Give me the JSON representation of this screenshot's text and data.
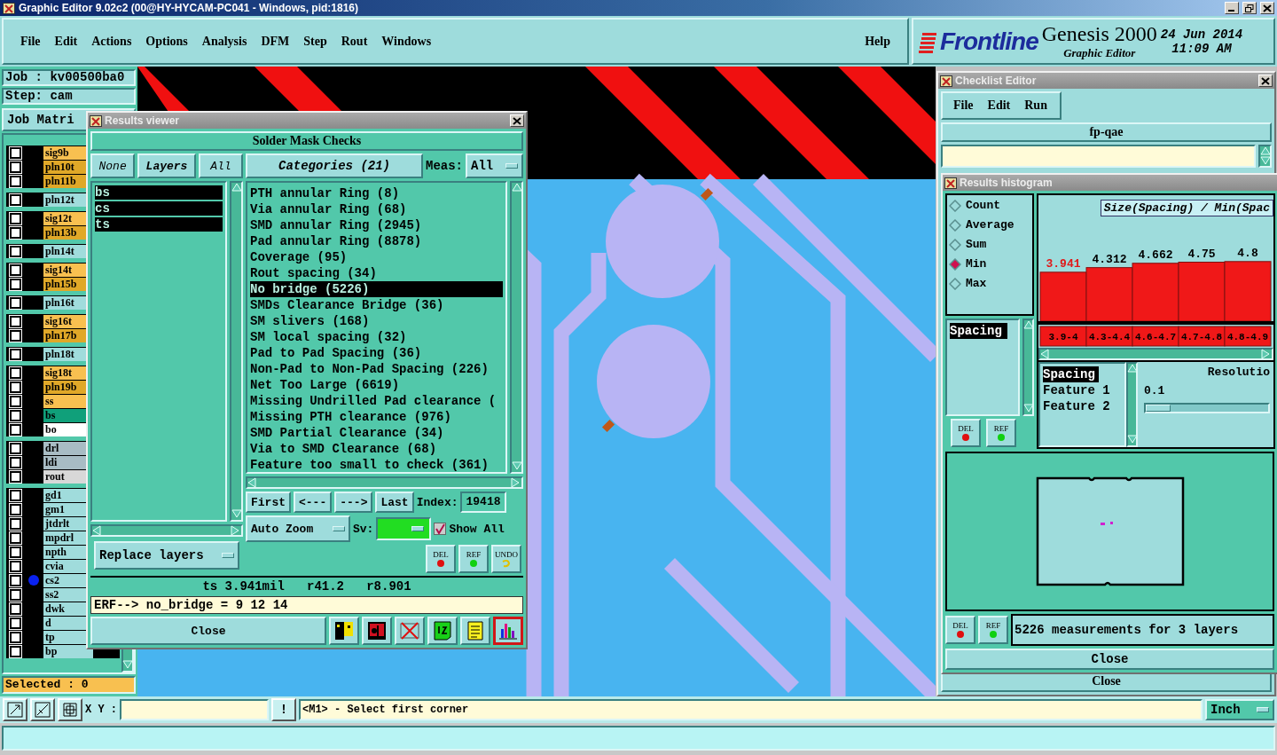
{
  "app_window": {
    "title": "Graphic Editor 9.02c2 (00@HY-HYCAM-PC041 - Windows, pid:1816)"
  },
  "menu": [
    "File",
    "Edit",
    "Actions",
    "Options",
    "Analysis",
    "DFM",
    "Step",
    "Rout",
    "Windows"
  ],
  "help_menu": "Help",
  "brand": {
    "logo": "Frontline",
    "product": "Genesis 2000",
    "date": "24 Jun 2014",
    "time": "11:09 AM",
    "subtitle": "Graphic Editor"
  },
  "job_panel": {
    "job": "Job : kv00500ba0",
    "step": "Step: cam",
    "matrix_button": "Job Matri",
    "selected_count": "Selected : 0",
    "layer_groups": [
      {
        "items": [
          {
            "name": "sig9b",
            "color": "#f8c050",
            "checked": false,
            "marked": false
          },
          {
            "name": "pln10t",
            "color": "#e0a828",
            "checked": false,
            "marked": false
          },
          {
            "name": "pln11b",
            "color": "#e0a828",
            "checked": false,
            "marked": false
          }
        ]
      },
      {
        "items": [
          {
            "name": "pln12t",
            "color": "#a0dcdc",
            "checked": false,
            "marked": false
          }
        ]
      },
      {
        "items": [
          {
            "name": "sig12t",
            "color": "#f8c050",
            "checked": false,
            "marked": false
          },
          {
            "name": "pln13b",
            "color": "#e0a828",
            "checked": false,
            "marked": false
          }
        ]
      },
      {
        "items": [
          {
            "name": "pln14t",
            "color": "#a0dcdc",
            "checked": false,
            "marked": false
          }
        ]
      },
      {
        "items": [
          {
            "name": "sig14t",
            "color": "#f8c050",
            "checked": false,
            "marked": false
          },
          {
            "name": "pln15b",
            "color": "#e0a828",
            "checked": false,
            "marked": false
          }
        ]
      },
      {
        "items": [
          {
            "name": "pln16t",
            "color": "#a0dcdc",
            "checked": false,
            "marked": false
          }
        ]
      },
      {
        "items": [
          {
            "name": "sig16t",
            "color": "#f8c050",
            "checked": false,
            "marked": false
          },
          {
            "name": "pln17b",
            "color": "#e0a828",
            "checked": false,
            "marked": false
          }
        ]
      },
      {
        "items": [
          {
            "name": "pln18t",
            "color": "#a0dcdc",
            "checked": false,
            "marked": false
          }
        ]
      },
      {
        "items": [
          {
            "name": "sig18t",
            "color": "#f8c050",
            "checked": false,
            "marked": false
          },
          {
            "name": "pln19b",
            "color": "#e0a828",
            "checked": false,
            "marked": false
          },
          {
            "name": "ss",
            "color": "#f8c050",
            "checked": false,
            "marked": false
          },
          {
            "name": "bs",
            "color": "#10a07a",
            "checked": false,
            "marked": false
          },
          {
            "name": "bo",
            "color": "#ffffff",
            "checked": false,
            "marked": false
          }
        ]
      },
      {
        "items": [
          {
            "name": "drl",
            "color": "#a8bcc4",
            "checked": false,
            "marked": false
          },
          {
            "name": "ldi",
            "color": "#a8bcc4",
            "checked": false,
            "marked": false
          },
          {
            "name": "rout",
            "color": "#d8d8d8",
            "checked": false,
            "marked": false
          }
        ]
      },
      {
        "items": [
          {
            "name": "gd1",
            "color": "#a0dcdc",
            "checked": false,
            "marked": false
          },
          {
            "name": "gm1",
            "color": "#a0dcdc",
            "checked": false,
            "marked": false
          },
          {
            "name": "jtdrlt",
            "color": "#a0dcdc",
            "checked": false,
            "marked": false
          },
          {
            "name": "mpdrl",
            "color": "#a0dcdc",
            "checked": false,
            "marked": false
          },
          {
            "name": "npth",
            "color": "#a0dcdc",
            "checked": false,
            "marked": false
          },
          {
            "name": "cvia",
            "color": "#a0dcdc",
            "checked": false,
            "marked": false
          },
          {
            "name": "cs2",
            "color": "#a0dcdc",
            "checked": false,
            "marked": true
          },
          {
            "name": "ss2",
            "color": "#a0dcdc",
            "checked": false,
            "marked": false
          },
          {
            "name": "dwk",
            "color": "#a0dcdc",
            "checked": false,
            "marked": false
          },
          {
            "name": "d",
            "color": "#a0dcdc",
            "checked": false,
            "marked": false
          },
          {
            "name": "tp",
            "color": "#a0dcdc",
            "checked": false,
            "marked": false
          },
          {
            "name": "bp",
            "color": "#a0dcdc",
            "checked": false,
            "marked": false
          }
        ]
      }
    ]
  },
  "results_viewer": {
    "title": "Results viewer",
    "heading": "Solder Mask Checks",
    "layer_buttons": [
      "None",
      "Layers",
      "All"
    ],
    "layers": [
      {
        "name": "bs",
        "selected": true
      },
      {
        "name": "cs",
        "selected": true
      },
      {
        "name": "ts",
        "selected": true
      }
    ],
    "categories_button": "Categories (21)",
    "meas_label": "Meas:",
    "meas_value": "All",
    "categories": [
      {
        "name": "PTH annular Ring (8)",
        "selected": false
      },
      {
        "name": "Via annular Ring (68)",
        "selected": false
      },
      {
        "name": "SMD annular Ring (2945)",
        "selected": false
      },
      {
        "name": "Pad annular Ring (8878)",
        "selected": false
      },
      {
        "name": "Coverage (95)",
        "selected": false
      },
      {
        "name": "Rout spacing (34)",
        "selected": false
      },
      {
        "name": "No bridge (5226)",
        "selected": true
      },
      {
        "name": "SMDs Clearance Bridge (36)",
        "selected": false
      },
      {
        "name": "SM slivers (168)",
        "selected": false
      },
      {
        "name": "SM local spacing (32)",
        "selected": false
      },
      {
        "name": "Pad to Pad Spacing (36)",
        "selected": false
      },
      {
        "name": "Non-Pad to Non-Pad Spacing (226)",
        "selected": false
      },
      {
        "name": "Net Too Large (6619)",
        "selected": false
      },
      {
        "name": "Missing Undrilled Pad clearance (",
        "selected": false
      },
      {
        "name": "Missing PTH clearance (976)",
        "selected": false
      },
      {
        "name": "SMD Partial Clearance (34)",
        "selected": false
      },
      {
        "name": "Via to SMD Clearance (68)",
        "selected": false
      },
      {
        "name": "Feature too small to check (361)",
        "selected": false
      }
    ],
    "nav_buttons": [
      "First",
      "<---",
      "--->",
      "Last"
    ],
    "index_label": "Index:",
    "index_value": "19418",
    "zoom_mode": "Auto Zoom",
    "sv_label": "Sv:",
    "show_all": {
      "label": "Show All",
      "checked": true
    },
    "action_buttons": [
      {
        "label": "DEL",
        "kind": "delete"
      },
      {
        "label": "REF",
        "kind": "refresh"
      },
      {
        "label": "UNDO",
        "kind": "undo"
      }
    ],
    "replace_mode": "Replace layers",
    "measurement": "ts 3.941mil   r41.2   r8.901",
    "erf": "ERF--> no_bridge = 9 12 14",
    "close": "Close",
    "tools": [
      {
        "kind": "contrast",
        "selected": false
      },
      {
        "kind": "record",
        "selected": false
      },
      {
        "kind": "cross",
        "selected": false
      },
      {
        "kind": "page",
        "selected": false
      },
      {
        "kind": "note",
        "selected": false
      },
      {
        "kind": "histogram",
        "selected": true
      }
    ]
  },
  "checklist_editor": {
    "title": "Checklist Editor",
    "menu": [
      "File",
      "Edit",
      "Run"
    ],
    "name": "fp-qae",
    "close": "Close"
  },
  "results_histogram": {
    "title": "Results histogram",
    "modes": [
      {
        "label": "Count",
        "selected": false
      },
      {
        "label": "Average",
        "selected": false
      },
      {
        "label": "Sum",
        "selected": false
      },
      {
        "label": "Min",
        "selected": true
      },
      {
        "label": "Max",
        "selected": false
      }
    ],
    "fields": [
      {
        "name": "Spacing",
        "selected": true
      }
    ],
    "buttons": [
      {
        "label": "DEL",
        "kind": "delete"
      },
      {
        "label": "REF",
        "kind": "refresh"
      }
    ],
    "chart_data": {
      "type": "bar",
      "title": "Size(Spacing) / Min(Spac",
      "categories": [
        "3.9-4",
        "4.3-4.4",
        "4.6-4.7",
        "4.7-4.8",
        "4.8-4.9"
      ],
      "values": [
        3.941,
        4.312,
        4.662,
        4.75,
        4.8
      ],
      "data_labels": true
    },
    "measure_list": [
      {
        "name": "Spacing",
        "selected": true
      },
      {
        "name": "Feature 1",
        "selected": false
      },
      {
        "name": "Feature 2",
        "selected": false
      }
    ],
    "resolution_label": "Resolutio",
    "resolution_value": "0.1",
    "resolution_slider": {
      "level": 0
    },
    "summary_buttons": [
      {
        "label": "DEL",
        "kind": "delete"
      },
      {
        "label": "REF",
        "kind": "refresh"
      }
    ],
    "summary": "5226 measurements for 3 layers",
    "close": "Close"
  },
  "status_bar": {
    "xy_label": "X Y :",
    "alert_button": "!",
    "message": "<M1> - Select first corner",
    "units": "Inch"
  }
}
